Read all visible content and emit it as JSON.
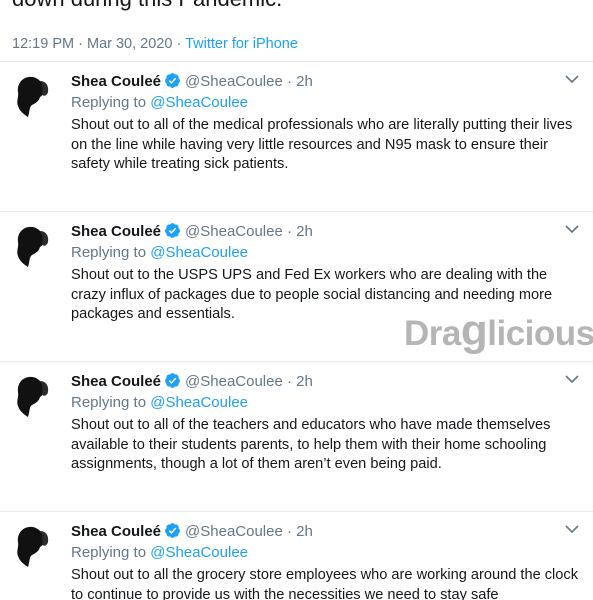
{
  "header": {
    "text_tail": "down during this Pandemic.",
    "time": "12:19 PM",
    "dot": "·",
    "date": "Mar 30, 2020",
    "source": "Twitter for iPhone"
  },
  "tweets": [
    {
      "name": "Shea Couleé",
      "handle": "@SheaCoulee",
      "dot": "·",
      "time": "2h",
      "replying_label": "Replying to",
      "replying_to": "@SheaCoulee",
      "text": "Shout out to all of the medical professionals who are literally putting their lives on the line while having very little resources and N95 mask to ensure their safety while treating sick patients."
    },
    {
      "name": "Shea Couleé",
      "handle": "@SheaCoulee",
      "dot": "·",
      "time": "2h",
      "replying_label": "Replying to",
      "replying_to": "@SheaCoulee",
      "text": "Shout out to the USPS UPS and Fed Ex workers who are dealing with the crazy influx of packages due to people social distancing and needing more packages and essentials."
    },
    {
      "name": "Shea Couleé",
      "handle": "@SheaCoulee",
      "dot": "·",
      "time": "2h",
      "replying_label": "Replying to",
      "replying_to": "@SheaCoulee",
      "text": "Shout out to all of the teachers and educators who have made themselves available to their students parents, to help them with their home schooling assignments, though a lot of them aren’t even being paid."
    },
    {
      "name": "Shea Couleé",
      "handle": "@SheaCoulee",
      "dot": "·",
      "time": "2h",
      "replying_label": "Replying to",
      "replying_to": "@SheaCoulee",
      "text": "Shout out to all the grocery store employees who are working around the clock to continue to provide us with the necessities we need to stay safe"
    }
  ],
  "watermark": {
    "part1": "Drag",
    "part2": "licious"
  },
  "colors": {
    "link": "#1da1f2",
    "muted": "#657786",
    "text": "#14171a",
    "divider": "#e6ecf0"
  },
  "icons": {
    "verified": "verified-badge-icon",
    "more": "chevron-down-icon"
  }
}
